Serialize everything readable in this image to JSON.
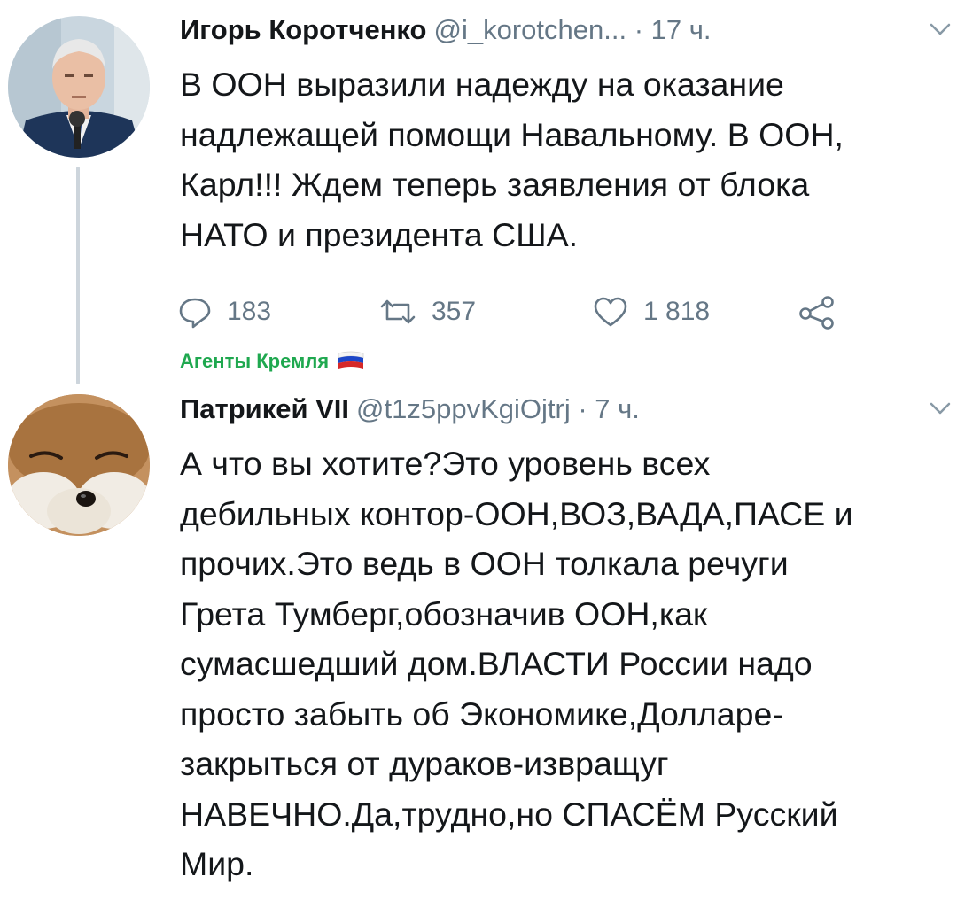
{
  "colors": {
    "text": "#14171a",
    "muted": "#657786",
    "thread_line": "#cdd5dc",
    "badge_green": "#1fa84f"
  },
  "tweet1": {
    "author_name": "Игорь Коротченко",
    "handle": "@i_korotchen...",
    "separator": "·",
    "time": "17 ч.",
    "text": "В ООН выразили надежду на оказание\nнадлежащей помощи Навальному. В ООН,\nКарл!!! Ждем теперь заявления от блока\nНАТО и президента США.",
    "actions": {
      "replies": "183",
      "retweets": "357",
      "likes": "1 818"
    }
  },
  "badge": {
    "text": "Агенты Кремля",
    "icon": "russian-flag-icon"
  },
  "tweet2": {
    "author_name": "Патрикей VII",
    "handle": "@t1z5ppvKgiOjtrj",
    "separator": "·",
    "time": "7 ч.",
    "text": "А что вы хотите?Это уровень всех\nдебильных контор-ООН,ВОЗ,ВАДА,ПАСЕ и\nпрочих.Это ведь в ООН толкала речуги\nГрета Тумберг,обозначив ООН,как\nсумасшедший дом.ВЛАСТИ России надо\nпросто забыть об Экономике,Долларе-\nзакрыться от дураков-извращуг\nНАВЕЧНО.Да,трудно,но СПАСЁМ Русский\nМир."
  }
}
